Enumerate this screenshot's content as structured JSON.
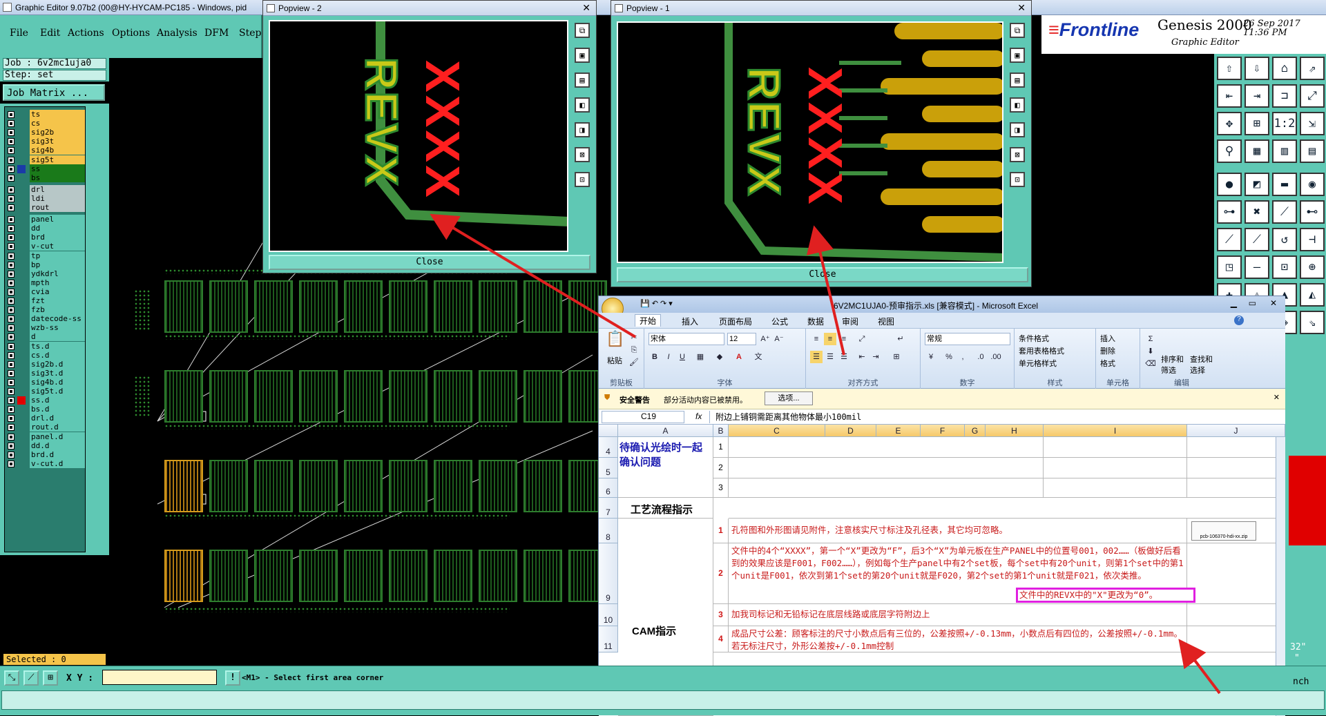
{
  "window": {
    "title": "Graphic Editor 9.07b2 (00@HY-HYCAM-PC185 - Windows, pid"
  },
  "menu": [
    "File",
    "Edit",
    "Actions",
    "Options",
    "Analysis",
    "DFM",
    "Step"
  ],
  "job": {
    "job_line": "Job : 6v2mc1uja0",
    "step_line": "Step: set",
    "matrix_button": "Job Matrix ..."
  },
  "layers": [
    "ts",
    "cs",
    "sig2b",
    "sig3t",
    "sig4b",
    "sig5t",
    "ss",
    "bs",
    "drl",
    "ldi",
    "rout",
    "panel",
    "dd",
    "brd",
    "v-cut",
    "tp",
    "bp",
    "ydkdrl",
    "mpth",
    "cvia",
    "fzt",
    "fzb",
    "datecode-ss",
    "wzb-ss",
    "d",
    "ts.d",
    "cs.d",
    "sig2b.d",
    "sig3t.d",
    "sig4b.d",
    "sig5t.d",
    "ss.d",
    "bs.d",
    "drl.d",
    "rout.d",
    "panel.d",
    "dd.d",
    "brd.d",
    "v-cut.d"
  ],
  "status": {
    "selected": "Selected : 0",
    "xy_label": "X Y :",
    "prompt": "<M1> - Select first area corner",
    "right_frag1": "32\"",
    "right_frag2": "\"",
    "right_frag3": "nch"
  },
  "popview2": {
    "title": "Popview - 2",
    "close": "Close",
    "revx": "REVX",
    "xxxx": "XXXX"
  },
  "popview1": {
    "title": "Popview - 1",
    "close": "Close",
    "revx": "REVX",
    "xxxx": "XXXX"
  },
  "frontline": {
    "logo": "Frontline",
    "genesis": "Genesis 2000",
    "sub": "Graphic Editor",
    "date": "26 Sep 2017",
    "time": "11:36 PM"
  },
  "excel": {
    "title": "6V2MC1UJA0-预审指示.xls [兼容模式] - Microsoft Excel",
    "tabs": [
      "开始",
      "插入",
      "页面布局",
      "公式",
      "数据",
      "审阅",
      "视图"
    ],
    "groups": {
      "clipboard": "剪贴板",
      "font": "字体",
      "align": "对齐方式",
      "number": "数字",
      "styles": "样式",
      "cells": "单元格",
      "edit": "编辑"
    },
    "paste": "粘贴",
    "font_name": "宋体",
    "font_size": "12",
    "number_format": "常规",
    "style_items": [
      "条件格式",
      "套用表格格式",
      "单元格样式"
    ],
    "cell_items": [
      "插入",
      "删除",
      "格式"
    ],
    "edit_items": [
      "排序和筛选",
      "查找和选择"
    ],
    "security": {
      "label": "安全警告",
      "text": "部分活动内容已被禁用。",
      "button": "选项..."
    },
    "namebox": "C19",
    "formula": "附边上铺铜需距离其他物体最小100mil",
    "columns": [
      "A",
      "B",
      "C",
      "D",
      "E",
      "F",
      "G",
      "H",
      "I",
      "J"
    ],
    "rows": [
      {
        "n": "4",
        "b": "1"
      },
      {
        "n": "5",
        "b": "2"
      },
      {
        "n": "6",
        "b": "3"
      },
      {
        "n": "7"
      },
      {
        "n": "8",
        "b": "1"
      },
      {
        "n": "9",
        "b": "2"
      },
      {
        "n": "10",
        "b": "3"
      },
      {
        "n": "11",
        "b": "4"
      }
    ],
    "a_confirm": "待确认光绘时一起确认问题",
    "a_flow": "工艺流程指示",
    "a_cam": "CAM指示",
    "c8": "孔符图和外形图请见附件，注意核实尺寸标注及孔径表，其它均可忽略。",
    "attachment": "pcb-106370-hdi-xx.zip",
    "c9": "文件中的4个“XXXX”，第一个“X”更改为“F”，后3个“X”为单元板在生产PANEL中的位置号001，002……（板做好后看到的效果应该是F001，F002……），例如每个生产panel中有2个set板，每个set中有20个unit，则第1个set中的第1个unit是F001，依次到第1个set的第20个unit就是F020，第2个set的第1个unit就是F021，依次类推。",
    "c9_highlight": "文件中的REVX中的\"X\"更改为“0”。",
    "c10": "加我司标记和无铅标记在底层线路或底层字符附边上",
    "c11": "成品尺寸公差：顾客标注的尺寸小数点后有三位的，公差按照+/-0.13mm，小数点后有四位的，公差按照+/-0.1mm。若无标注尺寸，外形公差按+/-0.1mm控制"
  },
  "colors": {
    "teal": "#5fc8b4",
    "amber": "#f5c44a",
    "annotation_red": "#e02020",
    "highlight": "#e020e0"
  }
}
